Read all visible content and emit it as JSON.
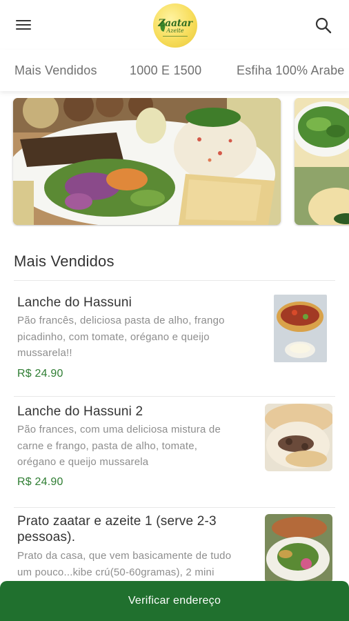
{
  "header": {
    "menu_icon": "hamburger-menu-icon",
    "logo": {
      "line1": "Zaatar",
      "line2": "Azeite"
    },
    "search_icon": "search-icon"
  },
  "category_tabs": [
    {
      "label": "Mais Vendidos"
    },
    {
      "label": "1000 E 1500"
    },
    {
      "label": "Esfiha 100% Arabe"
    }
  ],
  "section": {
    "title": "Mais Vendidos"
  },
  "products": [
    {
      "name": "Lanche do Hassuni",
      "description": [
        "Pão francês, deliciosa pasta de alho, frango",
        "picadinho, com tomate, orégano e queijo",
        "mussarela!!"
      ],
      "price": "R$ 24.90"
    },
    {
      "name": "Lanche do Hassuni 2",
      "description": [
        "Pão frances, com uma deliciosa mistura de",
        "carne e frango, pasta de alho, tomate,",
        "orégano e queijo mussarela"
      ],
      "price": "R$ 24.90"
    },
    {
      "name": [
        "Prato zaatar e azeite 1 (serve 2-3",
        "pessoas)."
      ],
      "description": [
        "Prato da casa, que vem basicamente de tudo",
        "um pouco...kibe crú(50-60gramas), 2 mini"
      ]
    }
  ],
  "bottom_button": {
    "label": "Verificar endereço"
  },
  "colors": {
    "accent_green": "#20702e",
    "price_green": "#2e7d32",
    "logo_yellow": "#f7dd5c"
  }
}
